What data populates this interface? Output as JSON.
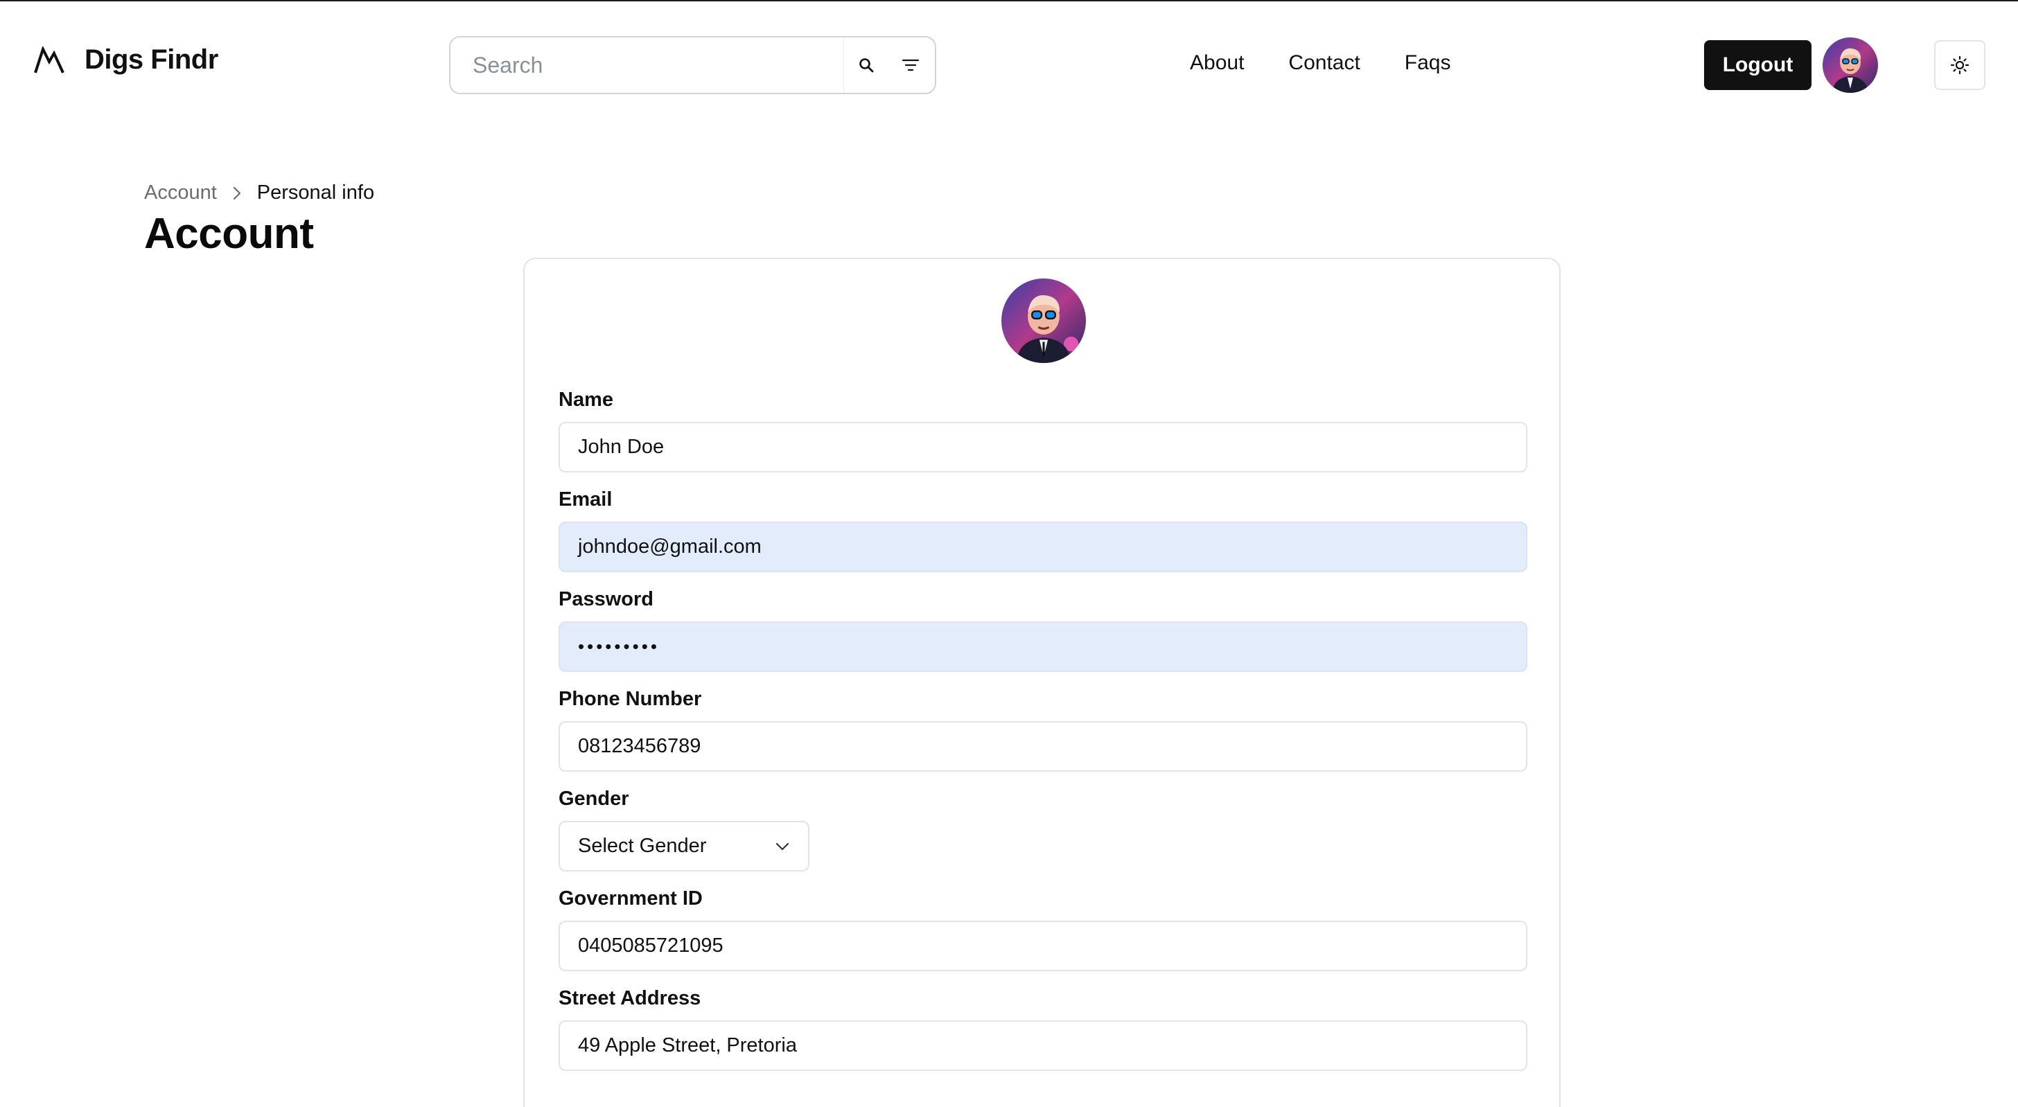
{
  "header": {
    "brand": "Digs Findr",
    "search_placeholder": "Search",
    "nav": [
      "About",
      "Contact",
      "Faqs"
    ],
    "logout_label": "Logout"
  },
  "breadcrumb": {
    "parent": "Account",
    "current": "Personal info"
  },
  "page_title": "Account",
  "form": {
    "name": {
      "label": "Name",
      "value": "John Doe"
    },
    "email": {
      "label": "Email",
      "value": "johndoe@gmail.com"
    },
    "password": {
      "label": "Password",
      "value": "•••••••••"
    },
    "phone": {
      "label": "Phone Number",
      "value": "08123456789"
    },
    "gender": {
      "label": "Gender",
      "value": "Select Gender"
    },
    "government_id": {
      "label": "Government ID",
      "value": "0405085721095"
    },
    "street_address": {
      "label": "Street Address",
      "value": "49 Apple Street, Pretoria"
    }
  },
  "colors": {
    "primary": "#111111",
    "autofill": "#e3ecfb",
    "border": "#e4e4e7"
  },
  "icons": [
    "mountain-logo-icon",
    "search-icon",
    "filter-icon",
    "user-avatar",
    "sun-icon",
    "chevron-right-icon",
    "chevron-down-icon"
  ]
}
